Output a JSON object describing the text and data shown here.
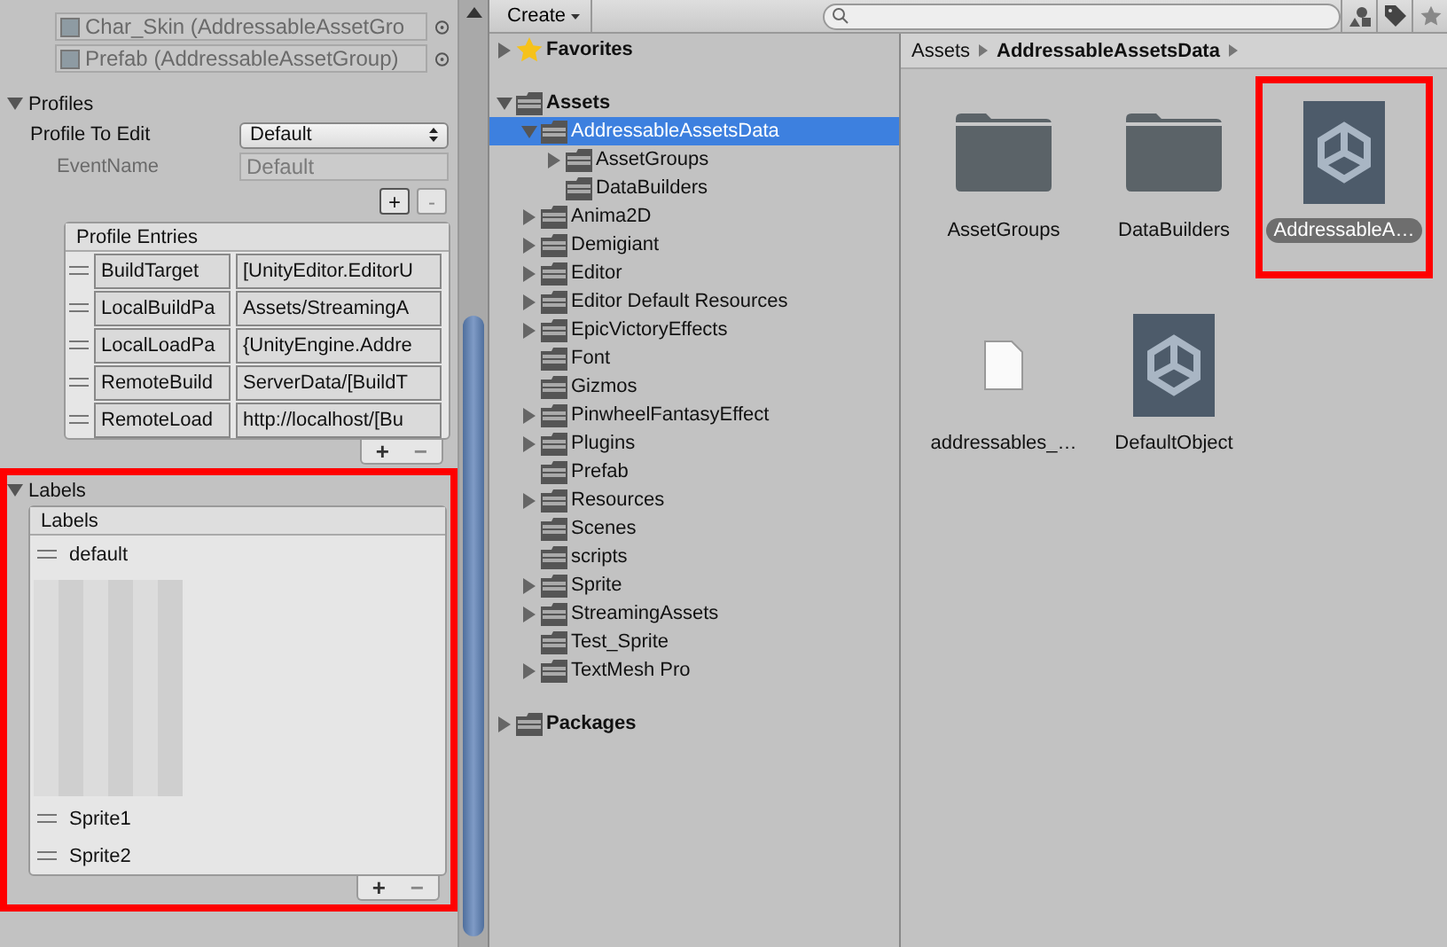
{
  "inspector": {
    "group_refs": [
      {
        "label": "Char_Skin (AddressableAssetGro"
      },
      {
        "label": "Prefab (AddressableAssetGroup)"
      }
    ],
    "profiles": {
      "title": "Profiles",
      "expanded": true,
      "profile_to_edit": {
        "label": "Profile To Edit",
        "value": "Default"
      },
      "event_name": {
        "label": "EventName",
        "value": "Default",
        "disabled": true
      },
      "add_button": "+",
      "remove_button": "-",
      "entries": {
        "header": "Profile Entries",
        "rows": [
          {
            "name": "BuildTarget",
            "value": "[UnityEditor.EditorU"
          },
          {
            "name": "LocalBuildPa",
            "value": "Assets/StreamingA"
          },
          {
            "name": "LocalLoadPa",
            "value": "{UnityEngine.Addre"
          },
          {
            "name": "RemoteBuild",
            "value": "ServerData/[BuildT"
          },
          {
            "name": "RemoteLoad",
            "value": "http://localhost/[Bu"
          }
        ],
        "add": "+",
        "remove": "−"
      }
    },
    "labels": {
      "title": "Labels",
      "expanded": true,
      "highlighted": true,
      "list": {
        "header": "Labels",
        "items": [
          {
            "kind": "text",
            "label": "default"
          },
          {
            "kind": "obscured"
          },
          {
            "kind": "text",
            "label": "Sprite1"
          },
          {
            "kind": "text",
            "label": "Sprite2"
          }
        ],
        "add": "+",
        "remove": "−"
      }
    }
  },
  "project": {
    "create_button": "Create",
    "tree": [
      {
        "kind": "favorites",
        "label": "Favorites",
        "expandable": true,
        "expanded": false,
        "selected": false
      },
      {
        "kind": "folder",
        "label": "Assets",
        "expandable": true,
        "expanded": true,
        "selected": false,
        "children": [
          {
            "kind": "folder",
            "label": "AddressableAssetsData",
            "expandable": true,
            "expanded": true,
            "selected": true,
            "children": [
              {
                "kind": "folder",
                "label": "AssetGroups",
                "expandable": true,
                "expanded": false,
                "selected": false
              },
              {
                "kind": "folder",
                "label": "DataBuilders",
                "expandable": false,
                "expanded": false,
                "selected": false
              }
            ]
          },
          {
            "kind": "folder",
            "label": "Anima2D",
            "expandable": true,
            "expanded": false,
            "selected": false
          },
          {
            "kind": "folder",
            "label": "Demigiant",
            "expandable": true,
            "expanded": false,
            "selected": false
          },
          {
            "kind": "folder",
            "label": "Editor",
            "expandable": true,
            "expanded": false,
            "selected": false
          },
          {
            "kind": "folder",
            "label": "Editor Default Resources",
            "expandable": true,
            "expanded": false,
            "selected": false
          },
          {
            "kind": "folder",
            "label": "EpicVictoryEffects",
            "expandable": true,
            "expanded": false,
            "selected": false
          },
          {
            "kind": "folder",
            "label": "Font",
            "expandable": false,
            "expanded": false,
            "selected": false
          },
          {
            "kind": "folder",
            "label": "Gizmos",
            "expandable": false,
            "expanded": false,
            "selected": false
          },
          {
            "kind": "folder",
            "label": "PinwheelFantasyEffect",
            "expandable": true,
            "expanded": false,
            "selected": false
          },
          {
            "kind": "folder",
            "label": "Plugins",
            "expandable": true,
            "expanded": false,
            "selected": false
          },
          {
            "kind": "folder",
            "label": "Prefab",
            "expandable": false,
            "expanded": false,
            "selected": false
          },
          {
            "kind": "folder",
            "label": "Resources",
            "expandable": true,
            "expanded": false,
            "selected": false
          },
          {
            "kind": "folder",
            "label": "Scenes",
            "expandable": false,
            "expanded": false,
            "selected": false
          },
          {
            "kind": "folder",
            "label": "scripts",
            "expandable": false,
            "expanded": false,
            "selected": false
          },
          {
            "kind": "folder",
            "label": "Sprite",
            "expandable": true,
            "expanded": false,
            "selected": false
          },
          {
            "kind": "folder",
            "label": "StreamingAssets",
            "expandable": true,
            "expanded": false,
            "selected": false
          },
          {
            "kind": "folder",
            "label": "Test_Sprite",
            "expandable": false,
            "expanded": false,
            "selected": false
          },
          {
            "kind": "folder",
            "label": "TextMesh Pro",
            "expandable": true,
            "expanded": false,
            "selected": false
          }
        ]
      },
      {
        "kind": "folder",
        "label": "Packages",
        "expandable": true,
        "expanded": false,
        "selected": false
      }
    ],
    "breadcrumb": [
      "Assets",
      "AddressableAssetsData"
    ],
    "assets": [
      {
        "kind": "folder",
        "label": "AssetGroups",
        "selected": false,
        "highlighted": false
      },
      {
        "kind": "folder",
        "label": "DataBuilders",
        "selected": false,
        "highlighted": false
      },
      {
        "kind": "unity",
        "label": "AddressableA…",
        "selected": true,
        "highlighted": true
      },
      {
        "kind": "file",
        "label": "addressables_…",
        "selected": false,
        "highlighted": false
      },
      {
        "kind": "unity",
        "label": "DefaultObject",
        "selected": false,
        "highlighted": false
      }
    ]
  }
}
